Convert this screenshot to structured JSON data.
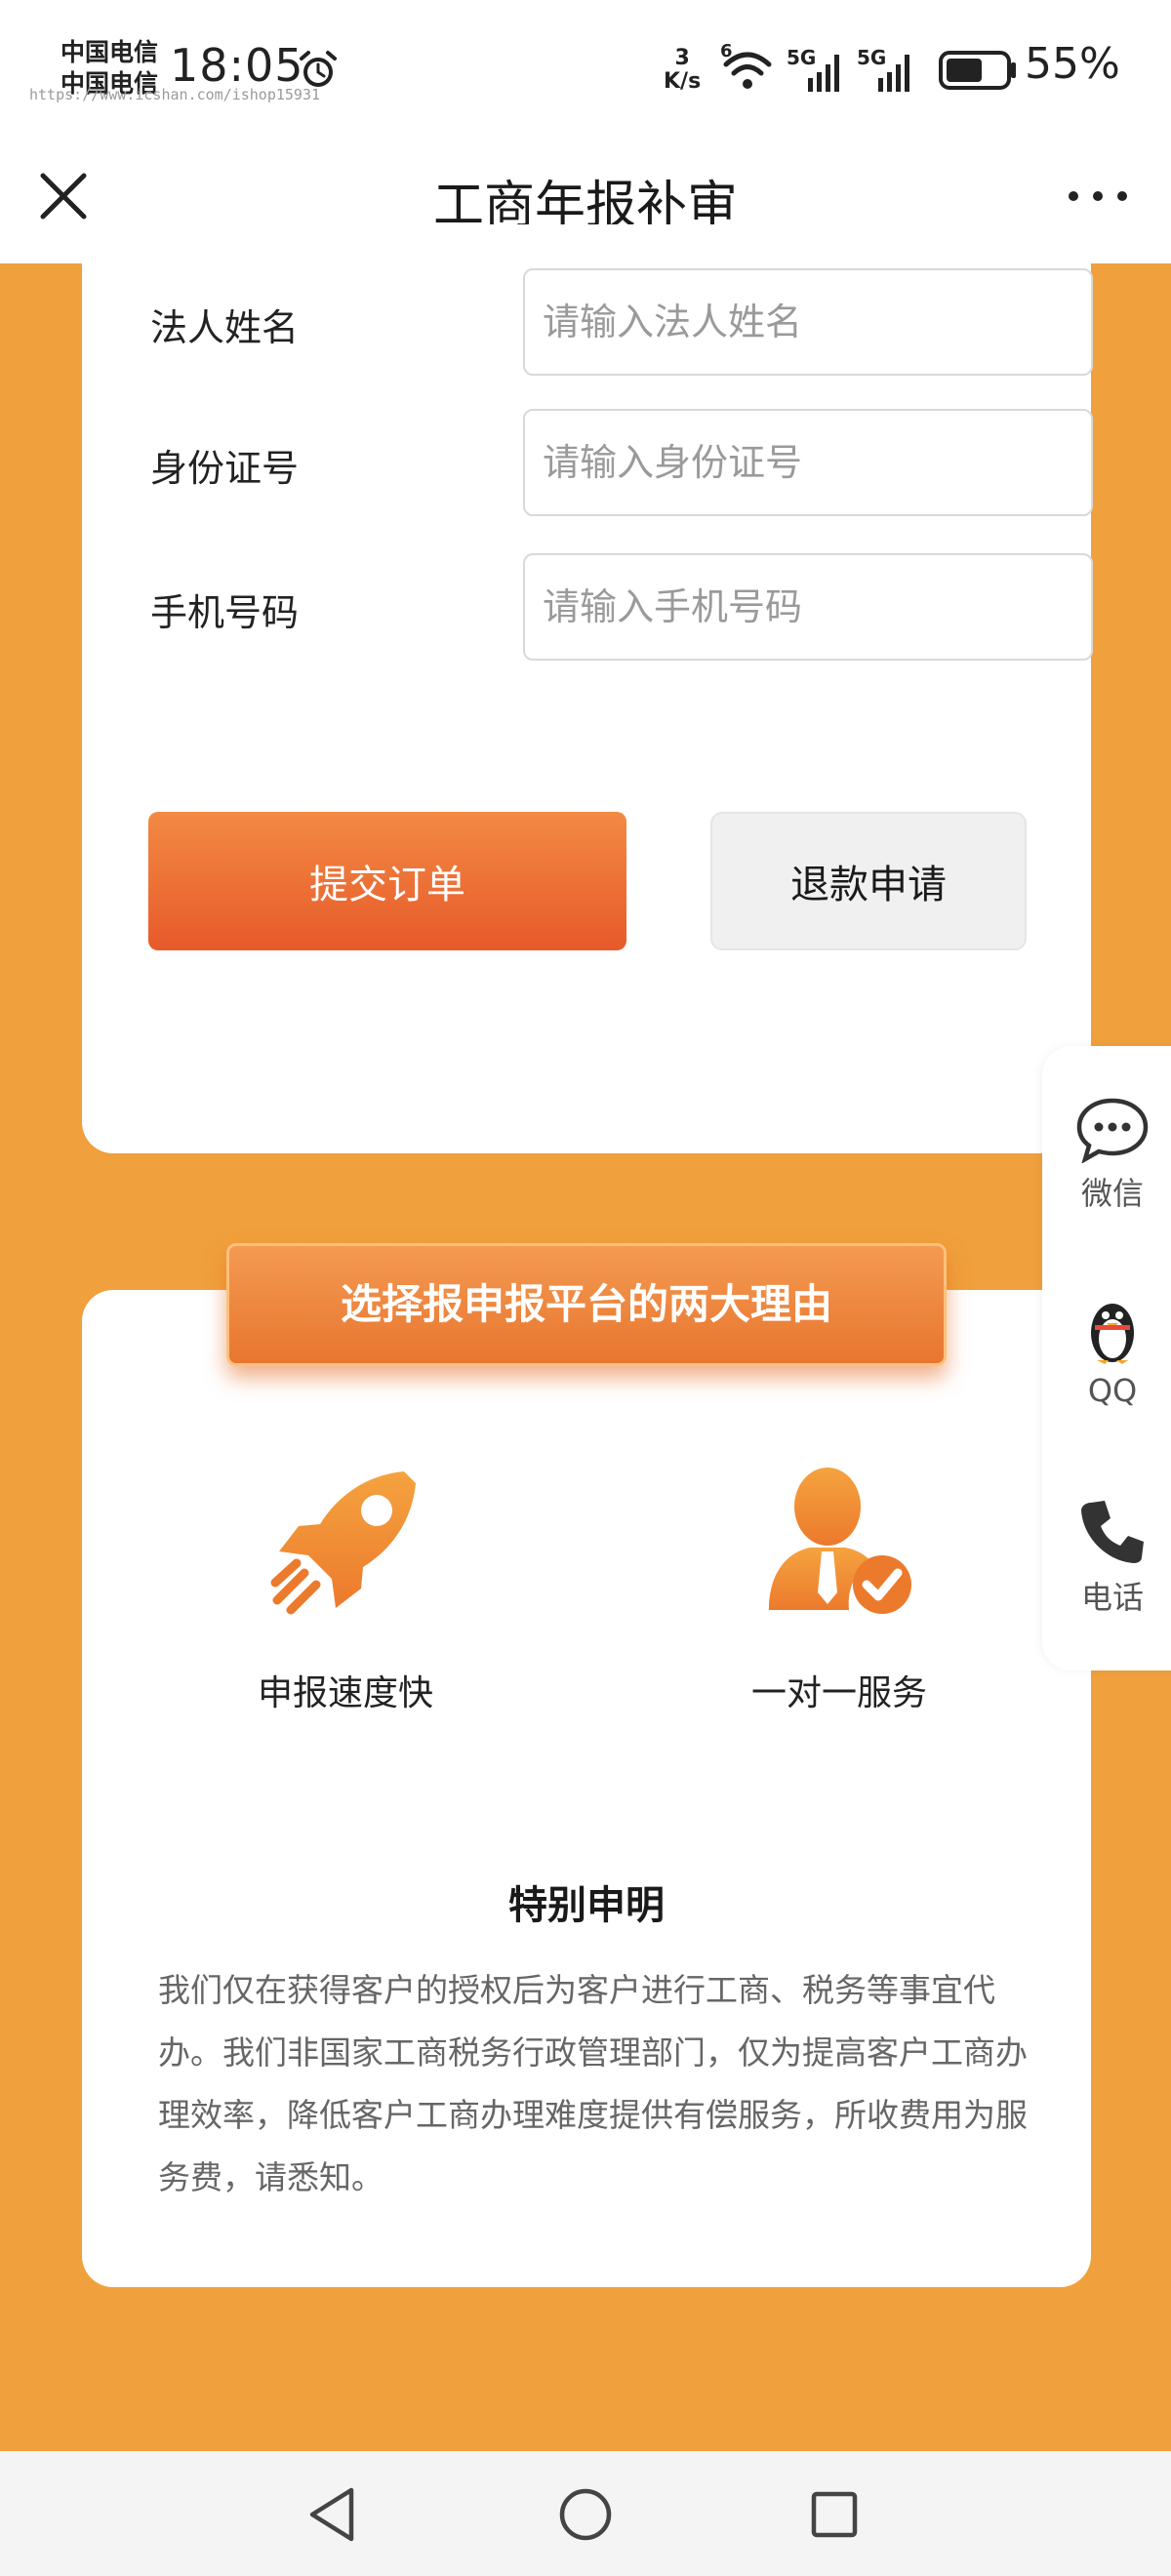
{
  "status_bar": {
    "carrier_1": "中国电信",
    "carrier_2": "中国电信",
    "time": "18:05",
    "net_speed_value": "3",
    "net_speed_unit": "K/s",
    "battery": "55%",
    "watermark": "https://www.icshan.com/ishop15931"
  },
  "header": {
    "title": "工商年报补审"
  },
  "form": {
    "fields": [
      {
        "label": "法人姓名",
        "placeholder": "请输入法人姓名"
      },
      {
        "label": "身份证号",
        "placeholder": "请输入身份证号"
      },
      {
        "label": "手机号码",
        "placeholder": "请输入手机号码"
      }
    ],
    "submit_label": "提交订单",
    "refund_label": "退款申请"
  },
  "reasons": {
    "banner": "选择报申报平台的两大理由",
    "features": [
      {
        "label": "申报速度快",
        "icon": "rocket-icon"
      },
      {
        "label": "一对一服务",
        "icon": "service-person-icon"
      }
    ],
    "notice_title": "特别申明",
    "notice_body": "我们仅在获得客户的授权后为客户进行工商、税务等事宜代办。我们非国家工商税务行政管理部门，仅为提高客户工商办理效率，降低客户工商办理难度提供有偿服务，所收费用为服务费，请悉知。"
  },
  "side_panel": {
    "items": [
      {
        "label": "微信",
        "icon": "chat-bubble-icon"
      },
      {
        "label": "QQ",
        "icon": "penguin-icon"
      },
      {
        "label": "电话",
        "icon": "phone-icon"
      }
    ]
  },
  "colors": {
    "background": "#F0A03C",
    "accent": "#E75A2A",
    "icon_orange": "#EF8A2E"
  }
}
